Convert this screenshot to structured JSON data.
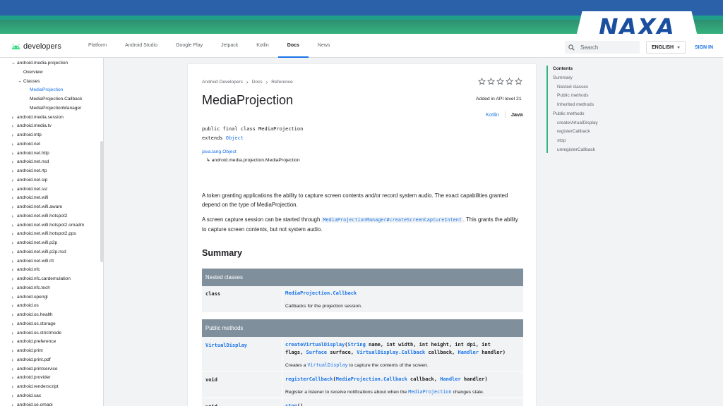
{
  "banner": {
    "logo": "NAXA"
  },
  "header": {
    "brand": "developers",
    "nav": [
      "Platform",
      "Android Studio",
      "Google Play",
      "Jetpack",
      "Kotlin",
      "Docs",
      "News"
    ],
    "active_nav": "Docs",
    "search_placeholder": "Search",
    "language": "ENGLISH",
    "signin": "SIGN IN"
  },
  "sidebar": {
    "items": [
      {
        "label": "android.media.projection",
        "indent": 0,
        "arrow": "down"
      },
      {
        "label": "Overview",
        "indent": 1,
        "arrow": "none"
      },
      {
        "label": "Classes",
        "indent": 1,
        "arrow": "down"
      },
      {
        "label": "MediaProjection",
        "indent": 2,
        "arrow": "none",
        "selected": true
      },
      {
        "label": "MediaProjection.Callback",
        "indent": 2,
        "arrow": "none"
      },
      {
        "label": "MediaProjectionManager",
        "indent": 2,
        "arrow": "none"
      },
      {
        "label": "android.media.session",
        "indent": 0,
        "arrow": "right"
      },
      {
        "label": "android.media.tv",
        "indent": 0,
        "arrow": "right"
      },
      {
        "label": "android.mtp",
        "indent": 0,
        "arrow": "right"
      },
      {
        "label": "android.net",
        "indent": 0,
        "arrow": "right"
      },
      {
        "label": "android.net.http",
        "indent": 0,
        "arrow": "right"
      },
      {
        "label": "android.net.nsd",
        "indent": 0,
        "arrow": "right"
      },
      {
        "label": "android.net.rtp",
        "indent": 0,
        "arrow": "right"
      },
      {
        "label": "android.net.sip",
        "indent": 0,
        "arrow": "right"
      },
      {
        "label": "android.net.ssl",
        "indent": 0,
        "arrow": "right"
      },
      {
        "label": "android.net.wifi",
        "indent": 0,
        "arrow": "right"
      },
      {
        "label": "android.net.wifi.aware",
        "indent": 0,
        "arrow": "right"
      },
      {
        "label": "android.net.wifi.hotspot2",
        "indent": 0,
        "arrow": "right"
      },
      {
        "label": "android.net.wifi.hotspot2.omadm",
        "indent": 0,
        "arrow": "right"
      },
      {
        "label": "android.net.wifi.hotspot2.pps",
        "indent": 0,
        "arrow": "right"
      },
      {
        "label": "android.net.wifi.p2p",
        "indent": 0,
        "arrow": "right"
      },
      {
        "label": "android.net.wifi.p2p.nsd",
        "indent": 0,
        "arrow": "right"
      },
      {
        "label": "android.net.wifi.rtt",
        "indent": 0,
        "arrow": "right"
      },
      {
        "label": "android.nfc",
        "indent": 0,
        "arrow": "right"
      },
      {
        "label": "android.nfc.cardemulation",
        "indent": 0,
        "arrow": "right"
      },
      {
        "label": "android.nfc.tech",
        "indent": 0,
        "arrow": "right"
      },
      {
        "label": "android.opengl",
        "indent": 0,
        "arrow": "right"
      },
      {
        "label": "android.os",
        "indent": 0,
        "arrow": "right"
      },
      {
        "label": "android.os.health",
        "indent": 0,
        "arrow": "right"
      },
      {
        "label": "android.os.storage",
        "indent": 0,
        "arrow": "right"
      },
      {
        "label": "android.os.strictmode",
        "indent": 0,
        "arrow": "right"
      },
      {
        "label": "android.preference",
        "indent": 0,
        "arrow": "right"
      },
      {
        "label": "android.print",
        "indent": 0,
        "arrow": "right"
      },
      {
        "label": "android.print.pdf",
        "indent": 0,
        "arrow": "right"
      },
      {
        "label": "android.printservice",
        "indent": 0,
        "arrow": "right"
      },
      {
        "label": "android.provider",
        "indent": 0,
        "arrow": "right"
      },
      {
        "label": "android.renderscript",
        "indent": 0,
        "arrow": "right"
      },
      {
        "label": "android.sax",
        "indent": 0,
        "arrow": "right"
      },
      {
        "label": "android.se.omapi",
        "indent": 0,
        "arrow": "right"
      }
    ]
  },
  "main": {
    "breadcrumbs": [
      "Android Developers",
      "Docs",
      "Reference"
    ],
    "title": "MediaProjection",
    "api_level": "Added in API level 21",
    "lang_tabs": {
      "kotlin": "Kotlin",
      "java": "Java"
    },
    "declaration": {
      "line1": "public final class MediaProjection",
      "extends_kw": "extends",
      "extends_cls": "Object"
    },
    "hierarchy": {
      "parent": "java.lang.Object",
      "child": "↳ android.media.projection.MediaProjection"
    },
    "para1": "A token granting applications the ability to capture screen contents and/or record system audio. The exact capabilities granted depend on the type of MediaProjection.",
    "para2_pre": "A screen capture session can be started through ",
    "para2_code": "MediaProjectionManager#createScreenCaptureIntent",
    "para2_post": ". This grants the ability to capture screen contents, but not system audio.",
    "summary_heading": "Summary",
    "nested_classes": {
      "header": "Nested classes",
      "rows": [
        {
          "type": "class",
          "name": "MediaProjection.Callback",
          "desc": "Callbacks for the projection session."
        }
      ]
    },
    "public_methods": {
      "header": "Public methods",
      "row1": {
        "ret": "VirtualDisplay",
        "m": "createVirtualDisplay",
        "p1t": "String",
        "p1": " name, int width, int height, int dpi, int",
        "l2a": "flags, ",
        "p2t": "Surface",
        "l2b": " surface, ",
        "p3t": "VirtualDisplay.Callback",
        "l2c": " callback, ",
        "p4t": "Handler",
        "l2d": " handler)",
        "desc_pre": "Creates a ",
        "desc_code": "VirtualDisplay",
        "desc_post": " to capture the contents of the screen."
      },
      "row2": {
        "ret": "void",
        "m": "registerCallback",
        "p1t": "MediaProjection.Callback",
        "p1": " callback, ",
        "p2t": "Handler",
        "p2": " handler)",
        "desc_pre": "Register a listener to receive notifications about when the ",
        "desc_code": "MediaProjection",
        "desc_post": " changes state."
      },
      "row3": {
        "ret": "void",
        "m": "stop",
        "rest": "()"
      }
    }
  },
  "toc": {
    "items": [
      {
        "label": "Contents",
        "level": 0
      },
      {
        "label": "Summary",
        "level": 0
      },
      {
        "label": "Nested classes",
        "level": 1
      },
      {
        "label": "Public methods",
        "level": 1
      },
      {
        "label": "Inherited methods",
        "level": 1
      },
      {
        "label": "Public methods",
        "level": 0
      },
      {
        "label": "createVirtualDisplay",
        "level": 1
      },
      {
        "label": "registerCallback",
        "level": 1
      },
      {
        "label": "stop",
        "level": 1
      },
      {
        "label": "unregisterCallback",
        "level": 1
      }
    ]
  },
  "colors": {
    "accent": "#1a73e8",
    "toc_bar": "#35b37e",
    "table_header": "#7f8f9c",
    "logo": "#1a4fa0"
  }
}
